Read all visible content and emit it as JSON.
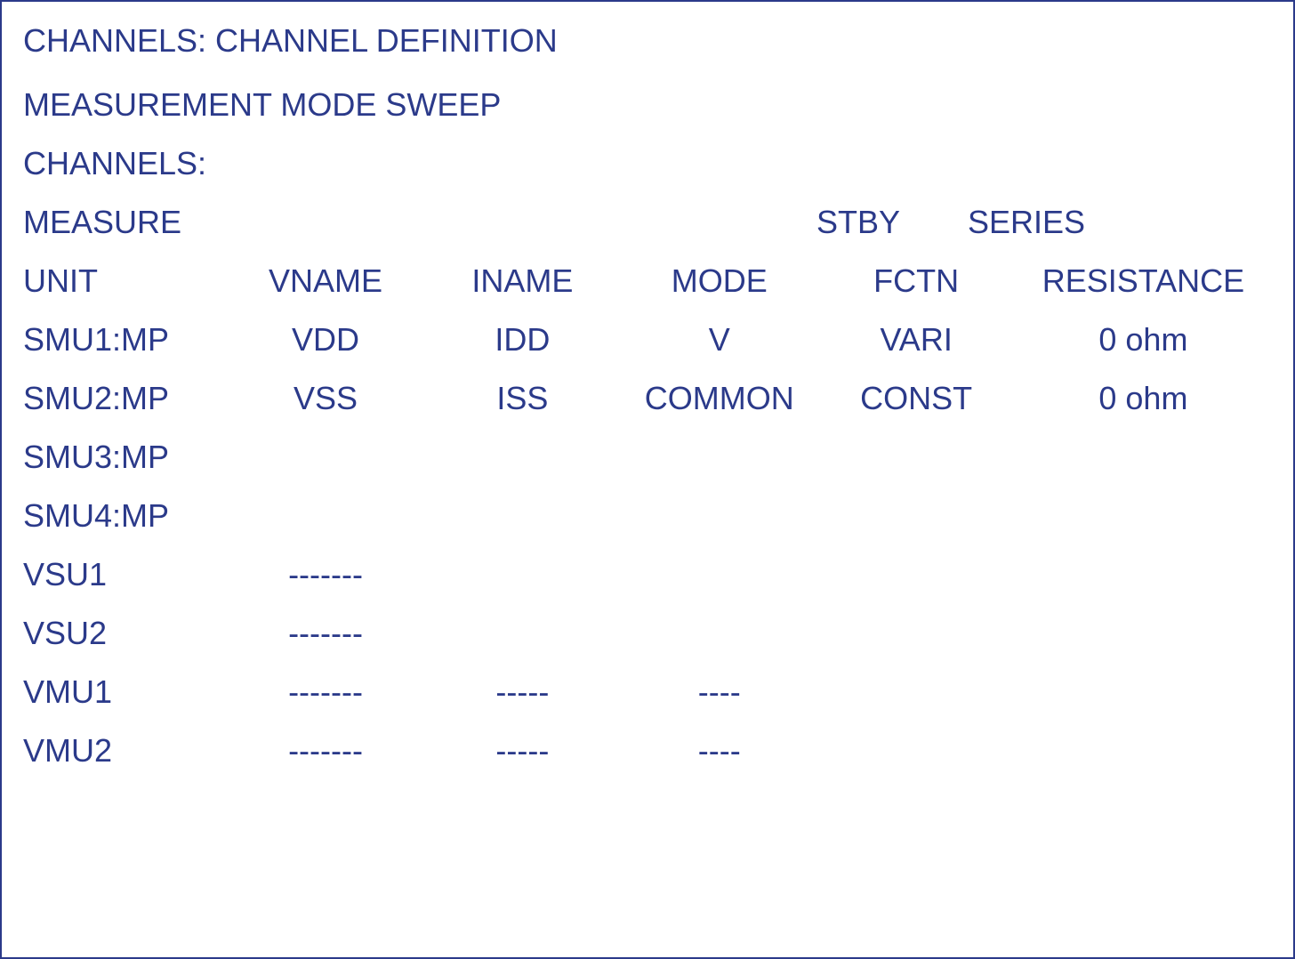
{
  "header": {
    "title": "CHANNELS: CHANNEL DEFINITION",
    "mode_line": "MEASUREMENT MODE SWEEP",
    "channels_label": "CHANNELS:",
    "measure_label": "MEASURE",
    "stby_label": "STBY",
    "series_label": "SERIES"
  },
  "columns": {
    "unit": "UNIT",
    "vname": "VNAME",
    "iname": "INAME",
    "mode": "MODE",
    "fctn": "FCTN",
    "resistance": "RESISTANCE"
  },
  "rows": [
    {
      "unit": "SMU1:MP",
      "vname": "VDD",
      "iname": "IDD",
      "mode": "V",
      "fctn": "VARI",
      "resistance": "0 ohm"
    },
    {
      "unit": "SMU2:MP",
      "vname": "VSS",
      "iname": "ISS",
      "mode": "COMMON",
      "fctn": "CONST",
      "resistance": "0 ohm"
    },
    {
      "unit": "SMU3:MP",
      "vname": "",
      "iname": "",
      "mode": "",
      "fctn": "",
      "resistance": ""
    },
    {
      "unit": "SMU4:MP",
      "vname": "",
      "iname": "",
      "mode": "",
      "fctn": "",
      "resistance": ""
    },
    {
      "unit": "VSU1",
      "vname": "-------",
      "iname": "",
      "mode": "",
      "fctn": "",
      "resistance": ""
    },
    {
      "unit": "VSU2",
      "vname": "-------",
      "iname": "",
      "mode": "",
      "fctn": "",
      "resistance": ""
    },
    {
      "unit": "VMU1",
      "vname": "-------",
      "iname": "-----",
      "mode": "----",
      "fctn": "",
      "resistance": ""
    },
    {
      "unit": "VMU2",
      "vname": "-------",
      "iname": "-----",
      "mode": "----",
      "fctn": "",
      "resistance": ""
    }
  ]
}
